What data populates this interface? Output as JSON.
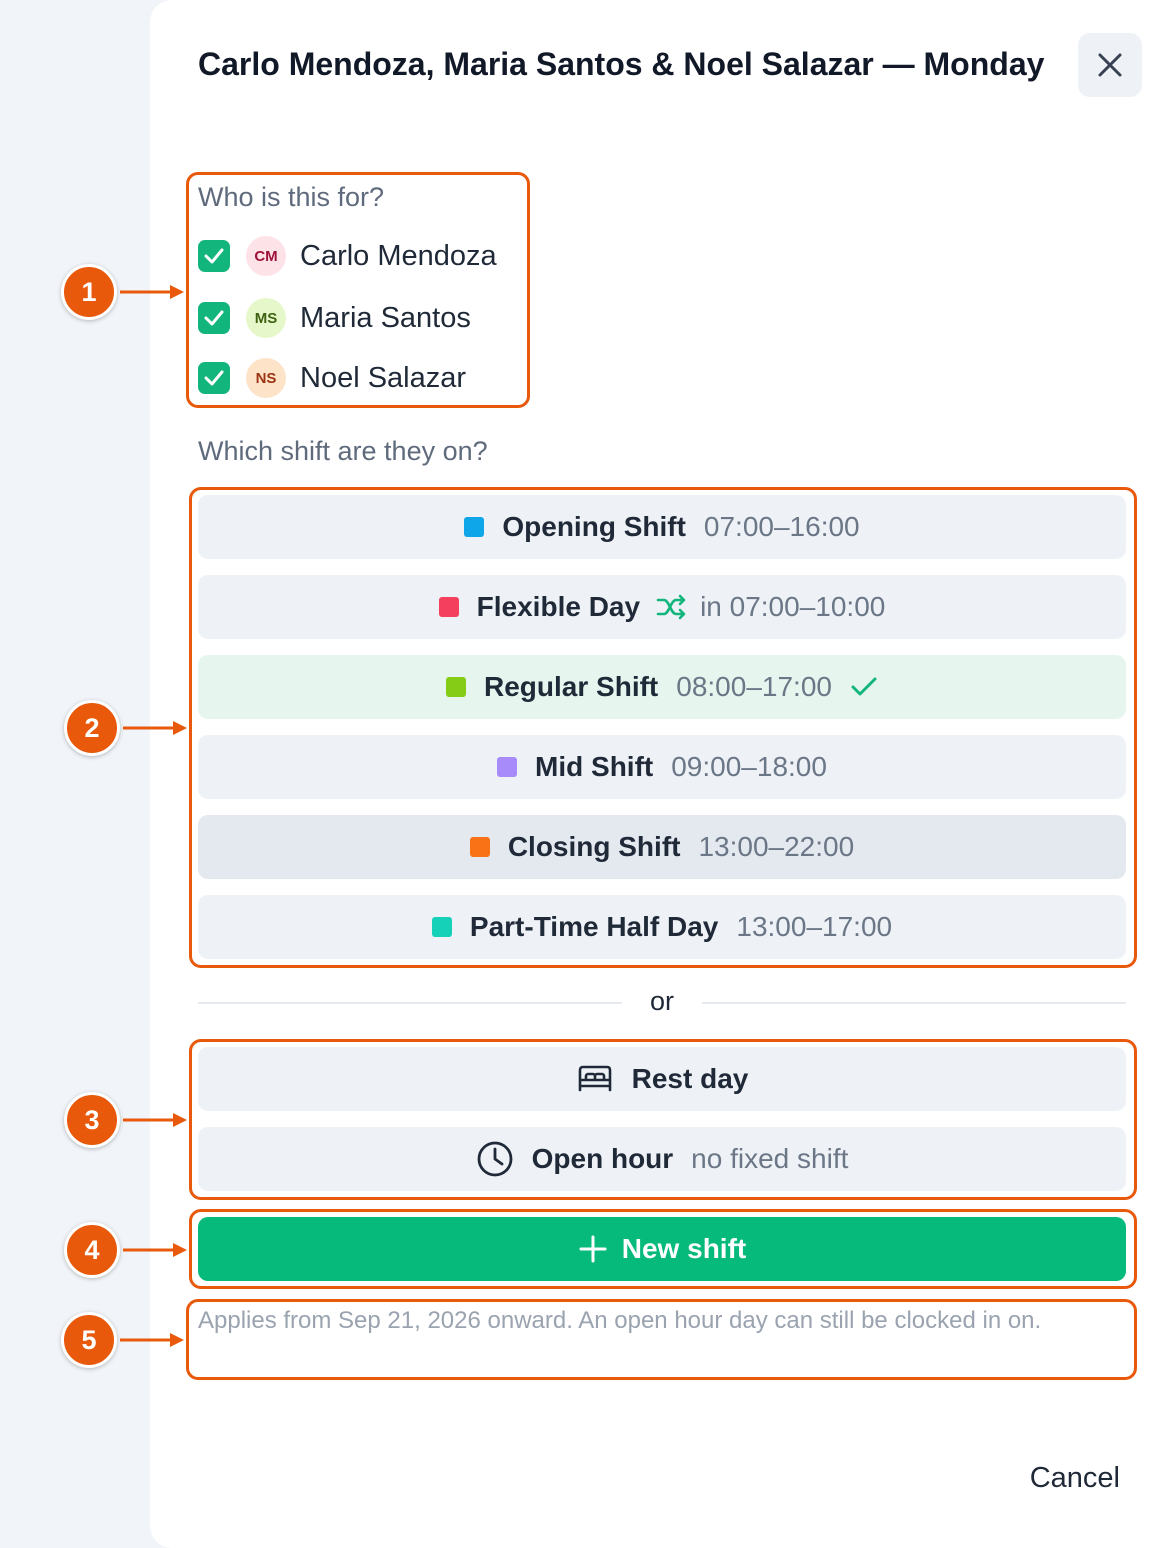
{
  "dialog": {
    "title": "Carlo Mendoza, Maria Santos & Noel Salazar — Monday",
    "close_icon": "close-icon"
  },
  "who": {
    "label": "Who is this for?",
    "people": [
      {
        "initials": "CM",
        "name": "Carlo Mendoza",
        "checked": true,
        "avatar_bg": "#fde2e7",
        "avatar_fg": "#9f1239"
      },
      {
        "initials": "MS",
        "name": "Maria Santos",
        "checked": true,
        "avatar_bg": "#e6f8c9",
        "avatar_fg": "#3f6212"
      },
      {
        "initials": "NS",
        "name": "Noel Salazar",
        "checked": true,
        "avatar_bg": "#fde3c8",
        "avatar_fg": "#9a3412"
      }
    ]
  },
  "shifts": {
    "label": "Which shift are they on?",
    "items": [
      {
        "name": "Opening Shift",
        "time": "07:00–16:00",
        "color": "#0ea5e9"
      },
      {
        "name": "Flexible Day",
        "time": "in 07:00–10:00",
        "color": "#f43f5e",
        "icon": "shuffle-icon"
      },
      {
        "name": "Regular Shift",
        "time": "08:00–17:00",
        "color": "#84cc16",
        "selected": true
      },
      {
        "name": "Mid Shift",
        "time": "09:00–18:00",
        "color": "#a78bfa"
      },
      {
        "name": "Closing Shift",
        "time": "13:00–22:00",
        "color": "#f97316"
      },
      {
        "name": "Part-Time Half Day",
        "time": "13:00–17:00",
        "color": "#14d1b8"
      }
    ]
  },
  "divider": {
    "text": "or"
  },
  "alternatives": {
    "rest_day": {
      "label": "Rest day",
      "icon": "bed-icon"
    },
    "open_hour": {
      "label": "Open hour",
      "sub": "no fixed shift",
      "icon": "clock-icon"
    }
  },
  "new_shift": {
    "label": "New shift",
    "icon": "plus-icon"
  },
  "footnote": "Applies from Sep 21, 2026 onward. An open hour day can still be clocked in on.",
  "cancel_label": "Cancel",
  "annotations": [
    "1",
    "2",
    "3",
    "4",
    "5"
  ],
  "colors": {
    "accent_green": "#05ba7b",
    "checkbox_green": "#12b57c",
    "annotation_orange": "#e8590c",
    "selected_row": "#e6f6ef"
  }
}
